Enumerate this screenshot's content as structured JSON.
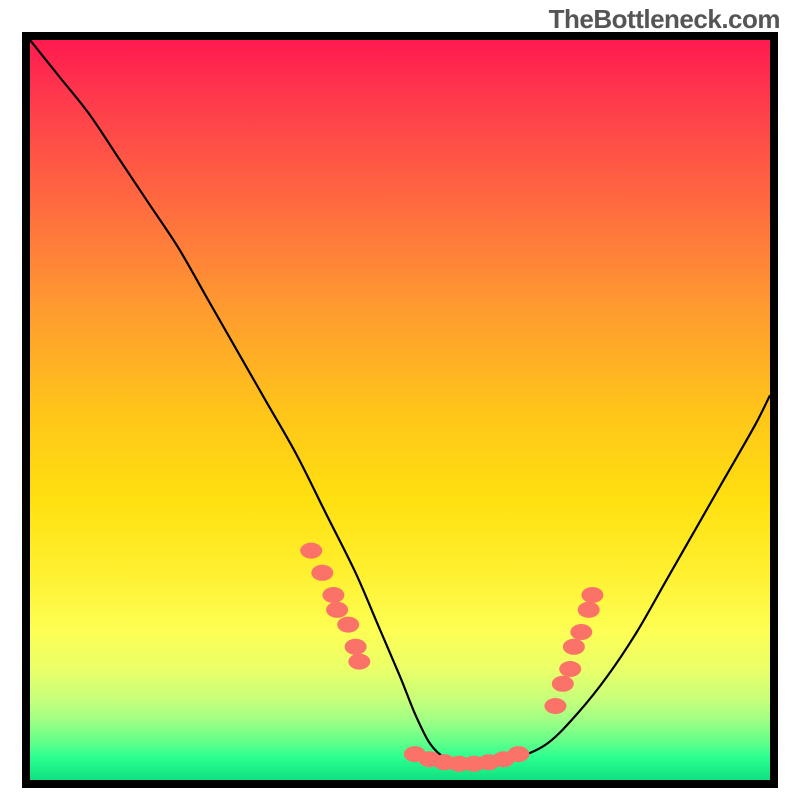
{
  "watermark": "TheBottleneck.com",
  "chart_data": {
    "type": "line",
    "title": "",
    "xlabel": "",
    "ylabel": "",
    "xlim": [
      0,
      100
    ],
    "ylim": [
      0,
      100
    ],
    "background_gradient": {
      "top": "#ff1a50",
      "middle": "#ffd020",
      "bottom": "#10e080"
    },
    "series": [
      {
        "name": "bottleneck-curve",
        "color": "#000000",
        "x": [
          0,
          4,
          8,
          12,
          16,
          20,
          24,
          28,
          32,
          36,
          40,
          44,
          47,
          50,
          52,
          54,
          56,
          58,
          60,
          63,
          66,
          70,
          74,
          78,
          82,
          86,
          90,
          94,
          98,
          100
        ],
        "y": [
          100,
          95,
          90,
          84,
          78,
          72,
          65,
          58,
          51,
          44,
          36,
          28,
          21,
          14,
          9,
          5,
          3,
          2,
          2,
          2,
          3,
          5,
          9,
          14,
          20,
          27,
          34,
          41,
          48,
          52
        ]
      },
      {
        "name": "highlight-markers-left",
        "color": "#fa7268",
        "type": "scatter",
        "x": [
          38,
          39.5,
          41,
          41.5,
          43,
          44,
          44.5
        ],
        "y": [
          31,
          28,
          25,
          23,
          21,
          18,
          16
        ]
      },
      {
        "name": "highlight-markers-bottom",
        "color": "#fa7268",
        "type": "scatter",
        "x": [
          52,
          54,
          56,
          58,
          60,
          62,
          64,
          66
        ],
        "y": [
          3.5,
          2.8,
          2.4,
          2.2,
          2.2,
          2.4,
          2.8,
          3.5
        ]
      },
      {
        "name": "highlight-markers-right",
        "color": "#fa7268",
        "type": "scatter",
        "x": [
          71,
          72,
          73,
          73.5,
          74.5,
          75.5,
          76
        ],
        "y": [
          10,
          13,
          15,
          18,
          20,
          23,
          25
        ]
      }
    ]
  }
}
